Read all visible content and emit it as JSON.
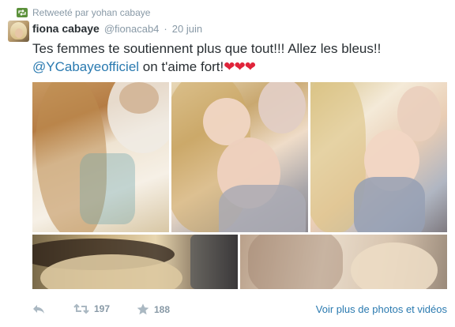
{
  "retweet_context": {
    "text": "Retweeté par yohan cabaye",
    "icon": "retweet-icon",
    "icon_color": "#5c913b"
  },
  "author": {
    "fullname": "fiona cabaye",
    "username": "@fionacab4",
    "separator": "·",
    "time": "20 juin"
  },
  "tweet": {
    "line1": "Tes femmes te soutiennent plus que tout!!! Allez les bleus!!",
    "mention": "@YCabayeofficiel",
    "line2_rest": " on t'aime fort!",
    "hearts": "❤❤❤",
    "heart_color": "#e0243a",
    "mention_color": "#2a7ab0"
  },
  "collage": {
    "photos": [
      {
        "name": "photo-1",
        "icon": "photo"
      },
      {
        "name": "photo-2",
        "icon": "photo"
      },
      {
        "name": "photo-3",
        "icon": "photo"
      },
      {
        "name": "photo-4",
        "icon": "photo"
      },
      {
        "name": "photo-5",
        "icon": "photo"
      }
    ]
  },
  "actions": {
    "reply_icon": "reply-icon",
    "retweet_icon": "retweet-icon",
    "retweet_count": "197",
    "favorite_icon": "star-icon",
    "favorite_count": "188",
    "more_photos": "Voir plus de photos et vidéos"
  }
}
